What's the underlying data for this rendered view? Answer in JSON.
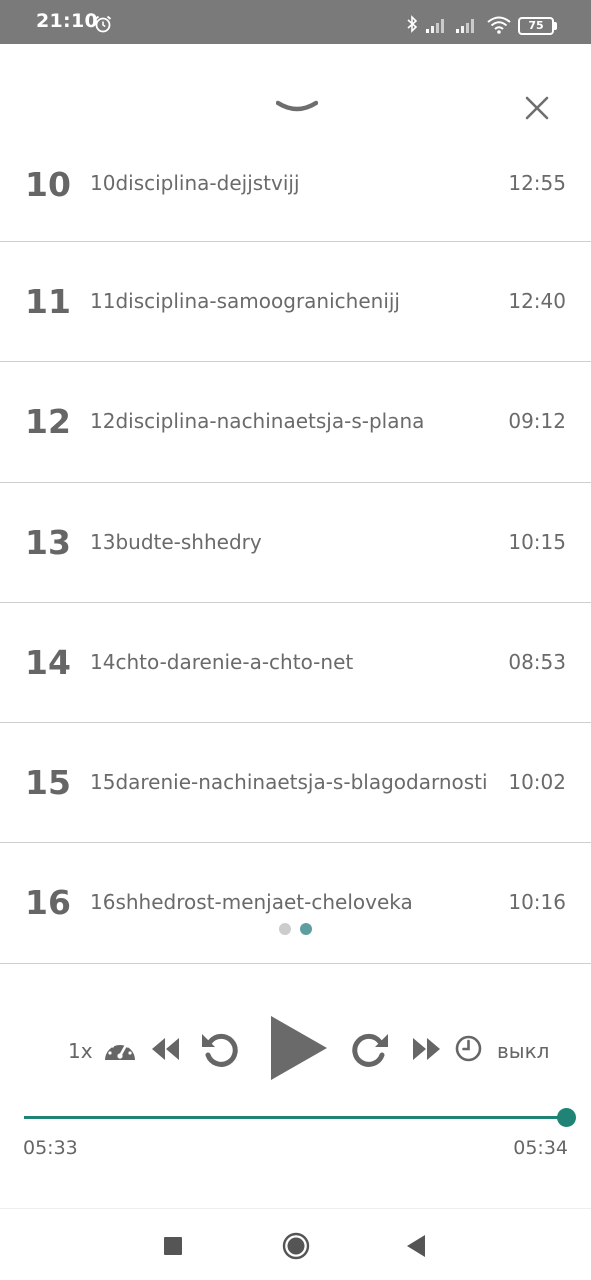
{
  "status_bar": {
    "time": "21:10",
    "battery": "75",
    "icons": [
      "alarm-clock-icon",
      "bluetooth-icon",
      "signal-icon",
      "signal-icon",
      "wifi-icon",
      "battery-icon"
    ]
  },
  "header": {
    "collapse_icon": "chevron-down-icon",
    "close_icon": "close-icon"
  },
  "tracks": [
    {
      "number": "10",
      "title": "10disciplina-dejjstvijj",
      "duration": "12:55"
    },
    {
      "number": "11",
      "title": "11disciplina-samoogranichenijj",
      "duration": "12:40"
    },
    {
      "number": "12",
      "title": "12disciplina-nachinaetsja-s-plana",
      "duration": "09:12"
    },
    {
      "number": "13",
      "title": "13budte-shhedry",
      "duration": "10:15"
    },
    {
      "number": "14",
      "title": "14chto-darenie-a-chto-net",
      "duration": "08:53"
    },
    {
      "number": "15",
      "title": "15darenie-nachinaetsja-s-blagodarnosti",
      "duration": "10:02"
    },
    {
      "number": "16",
      "title": "16shhedrost-menjaet-cheloveka",
      "duration": "10:16"
    }
  ],
  "pager": {
    "pages": 2,
    "active_page": 2
  },
  "player": {
    "speed": "1x",
    "sleep_timer": "выкл",
    "elapsed": "05:33",
    "total": "05:34",
    "progress_fraction": 0.997,
    "accent_color": "#1f8375",
    "icons": [
      "speedometer-icon",
      "skip-back-icon",
      "replay-icon",
      "play-icon",
      "forward-icon",
      "skip-forward-icon",
      "timer-icon"
    ]
  },
  "nav_bar": {
    "icons": [
      "recents-square-icon",
      "home-circle-icon",
      "back-triangle-icon"
    ]
  }
}
